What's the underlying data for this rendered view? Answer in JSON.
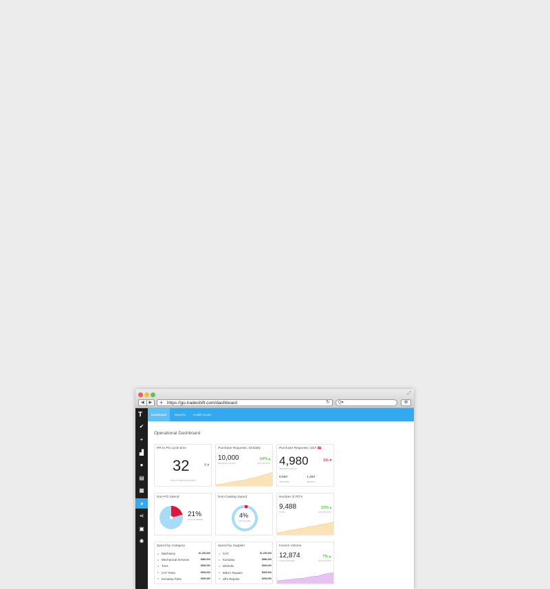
{
  "browser": {
    "url": "https://go.tradeshift.com/dashboard",
    "back_glyph": "◀",
    "forward_glyph": "▶",
    "new_tab_glyph": "+",
    "reload_glyph": "↻",
    "search_glyph": "Q▾",
    "download_glyph": "⊕",
    "expand_glyph": "⤢"
  },
  "sidebar": {
    "logo": "T",
    "items": [
      {
        "icon": "check-icon",
        "glyph": "✔"
      },
      {
        "icon": "plus-icon",
        "glyph": "+"
      },
      {
        "icon": "building-icon",
        "glyph": "▟"
      },
      {
        "icon": "globe-icon",
        "glyph": "●"
      },
      {
        "icon": "document-icon",
        "glyph": "▤"
      },
      {
        "icon": "apps-grid-icon",
        "glyph": "▦"
      },
      {
        "icon": "dashboard-pie-icon",
        "glyph": "◕"
      },
      {
        "icon": "share-icon",
        "glyph": "⋖"
      },
      {
        "icon": "lock-icon",
        "glyph": "▣"
      },
      {
        "icon": "help-icon",
        "glyph": "✺"
      }
    ]
  },
  "tabs": [
    {
      "label": "Dashboard",
      "active": true
    },
    {
      "label": "Reports",
      "active": false
    },
    {
      "label": "Health Score",
      "active": false
    }
  ],
  "page": {
    "title": "Operational Dashboard"
  },
  "colors": {
    "accent": "#35a9ef",
    "up": "#4cd137",
    "down": "#ef3340",
    "area_orange": "#fbe3b7",
    "area_purple": "#e5c4f4",
    "pie_blue": "#a8dbf7",
    "pie_red": "#e4143c"
  },
  "cards": {
    "pr_cycle": {
      "title": "PR to PO cycle time",
      "value": "32",
      "delta": "4 ▾",
      "label": "Days to resolve in 2015"
    },
    "pr_global": {
      "title": "Purchase Requests, Globally",
      "value": "10,000",
      "label": "Requests in 2014",
      "delta": "14% ▴",
      "delta_label": "Last 30 days"
    },
    "pr_usa": {
      "title": "Purchase Requests, USA",
      "value": "4,980",
      "label": "Requests in 2014",
      "delta": "1% ▾",
      "approved_value": "8,550",
      "approved_label": "Approved",
      "pending_value": "1,450",
      "pending_label": "Pending"
    },
    "non_po": {
      "title": "Non-PO Spend",
      "percent": "21%",
      "label": "Of % Of Spend",
      "fraction": 0.21
    },
    "non_catalog": {
      "title": "Non-Catalog Spend",
      "percent": "4%",
      "label": "Of Volume",
      "fraction": 0.04
    },
    "num_pos": {
      "title": "Number of PO's",
      "value": "9,488",
      "label": "Total",
      "delta": "13% ▴",
      "delta_label": "Last 30 days"
    },
    "spend_category": {
      "title": "Spend by Category",
      "items": [
        {
          "name": "Machinery",
          "amount": "$1,200,000"
        },
        {
          "name": "Mechanical Services",
          "amount": "$880,000"
        },
        {
          "name": "Tires",
          "amount": "$530,000"
        },
        {
          "name": "CAT Parts",
          "amount": "$300,000"
        },
        {
          "name": "Komatsu Parts",
          "amount": "$200,000"
        }
      ]
    },
    "spend_supplier": {
      "title": "Spend by Supplier",
      "items": [
        {
          "name": "CAT",
          "amount": "$1,200,000"
        },
        {
          "name": "Komatsu",
          "amount": "$880,000"
        },
        {
          "name": "Michelin",
          "amount": "$530,000"
        },
        {
          "name": "Mike's Repairs",
          "amount": "$300,000"
        },
        {
          "name": "Jill's Repairs",
          "amount": "$200,000"
        }
      ]
    },
    "invoice_volume": {
      "title": "Invoice Volume",
      "value": "12,874",
      "label": "Total Invoices",
      "delta": "7% ▴",
      "delta_label": "Last 30 days"
    }
  }
}
